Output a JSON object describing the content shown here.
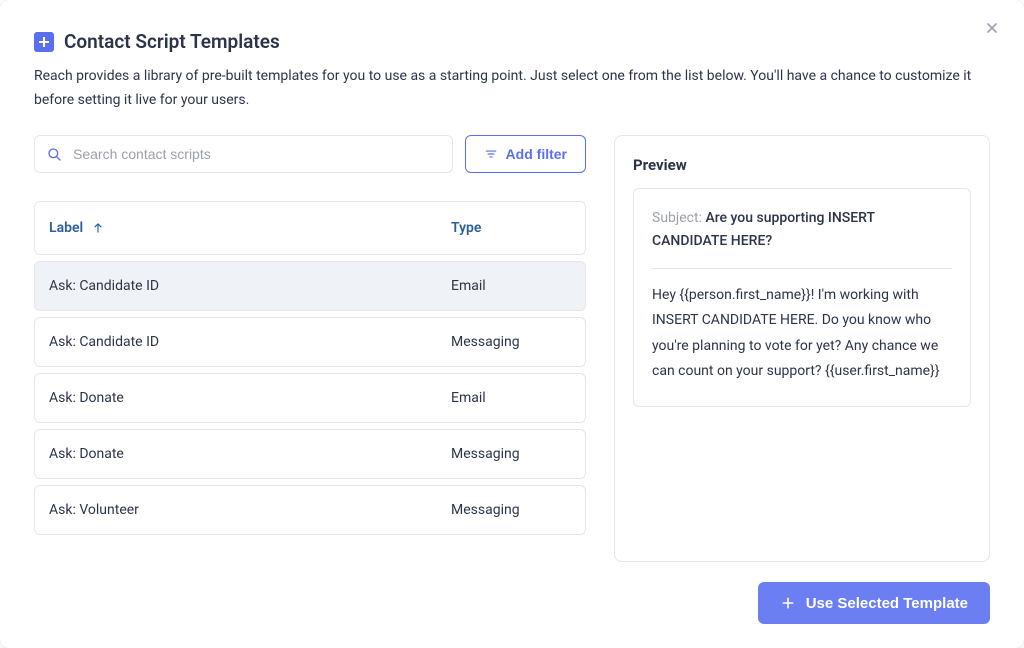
{
  "header": {
    "title": "Contact Script Templates",
    "subtitle": "Reach provides a library of pre-built templates for you to use as a starting point. Just select one from the list below. You'll have a chance to customize it before setting it live for your users."
  },
  "toolbar": {
    "search_placeholder": "Search contact scripts",
    "filter_label": "Add filter"
  },
  "table": {
    "columns": {
      "label": "Label",
      "type": "Type"
    },
    "rows": [
      {
        "label": "Ask: Candidate ID",
        "type": "Email",
        "selected": true
      },
      {
        "label": "Ask: Candidate ID",
        "type": "Messaging",
        "selected": false
      },
      {
        "label": "Ask: Donate",
        "type": "Email",
        "selected": false
      },
      {
        "label": "Ask: Donate",
        "type": "Messaging",
        "selected": false
      },
      {
        "label": "Ask: Volunteer",
        "type": "Messaging",
        "selected": false
      }
    ]
  },
  "preview": {
    "title": "Preview",
    "subject_label": "Subject:",
    "subject_value": "Are you supporting INSERT CANDIDATE HERE?",
    "body": "Hey {{person.first_name}}! I'm working with INSERT CANDIDATE HERE. Do you know who you're planning to vote for yet? Any chance we can count on your support? {{user.first_name}}"
  },
  "footer": {
    "primary_label": "Use Selected Template"
  }
}
